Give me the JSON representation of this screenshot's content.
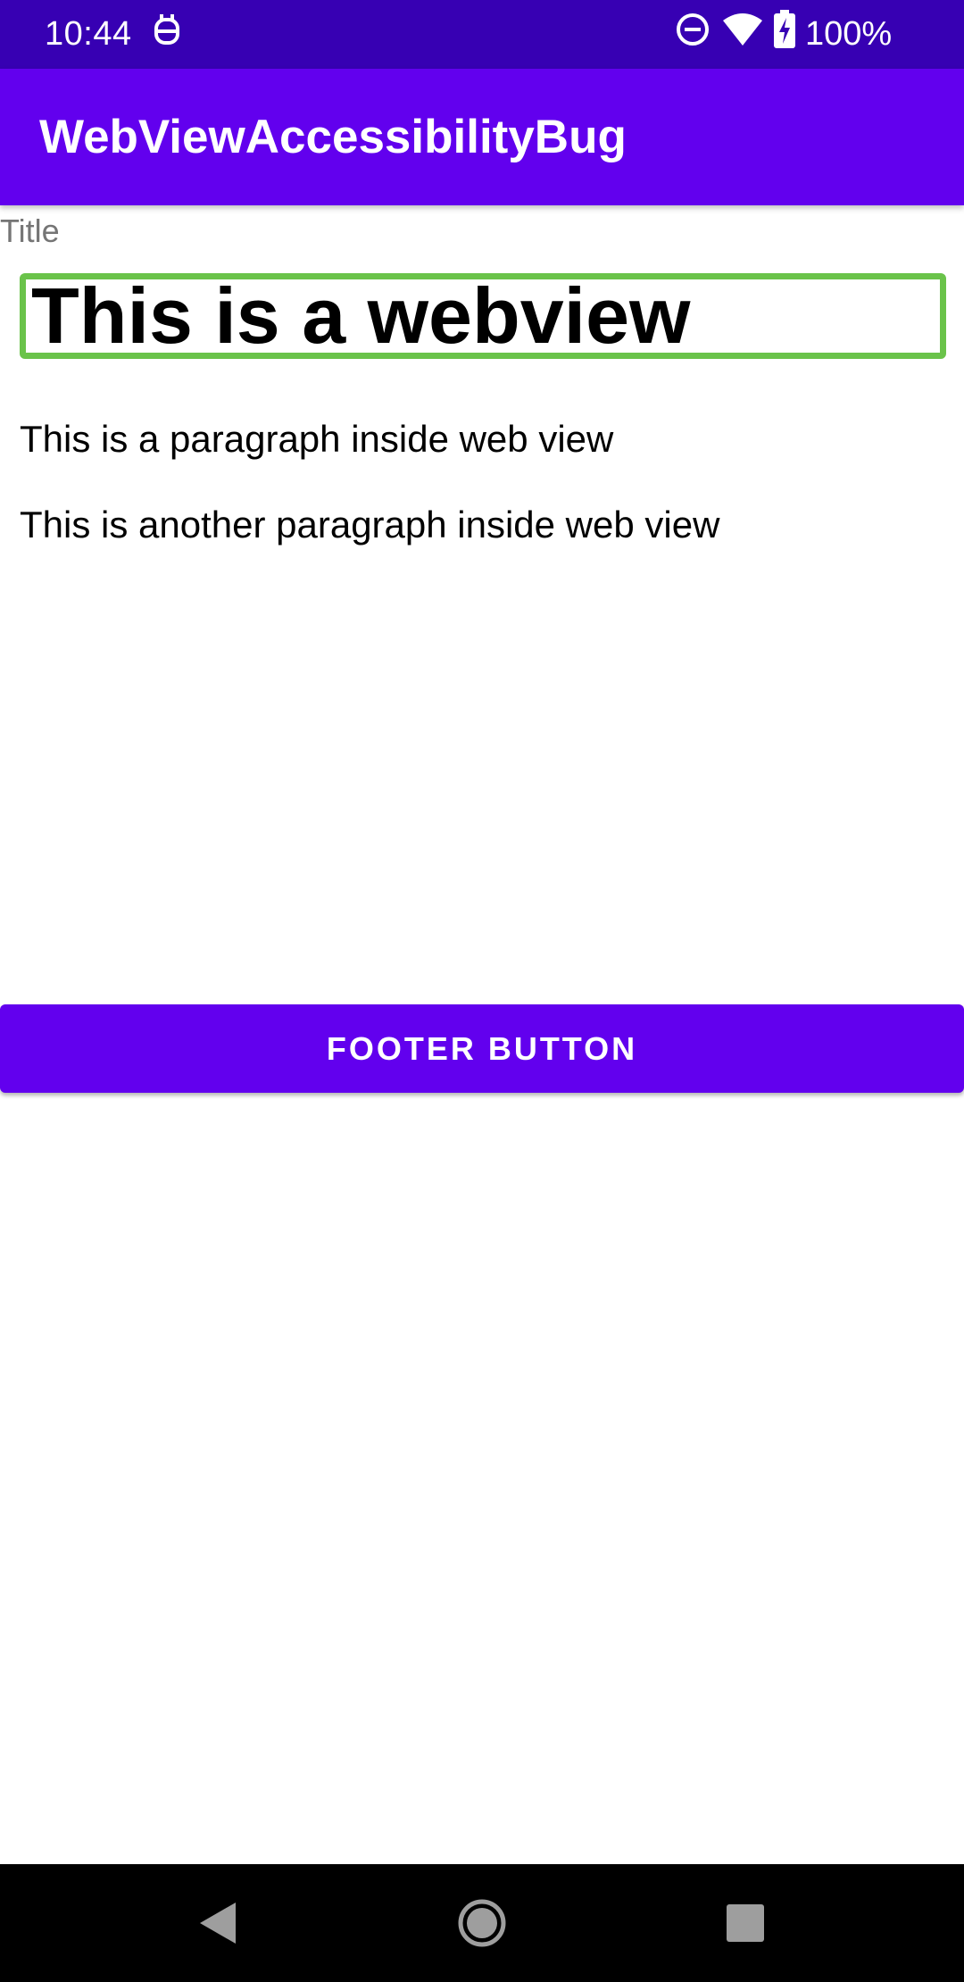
{
  "status_bar": {
    "time": "10:44",
    "battery_text": "100%",
    "icons": [
      "notification-app-icon",
      "do-not-disturb-icon",
      "wifi-icon",
      "battery-charging-icon"
    ]
  },
  "app_bar": {
    "title": "WebViewAccessibilityBug"
  },
  "content": {
    "title_label": "Title",
    "webview": {
      "heading": "This is a webview",
      "paragraphs": [
        "This is a paragraph inside web view",
        "This is another paragraph inside web view"
      ],
      "focus_highlight_color": "#6ac34a"
    },
    "footer_button_label": "FOOTER BUTTON"
  },
  "nav_bar": {
    "icons": [
      "back-icon",
      "home-icon",
      "recents-icon"
    ]
  },
  "colors": {
    "status_bar": "#3700b3",
    "app_bar": "#6200ee",
    "button": "#6200ee",
    "nav_bar": "#000000"
  }
}
